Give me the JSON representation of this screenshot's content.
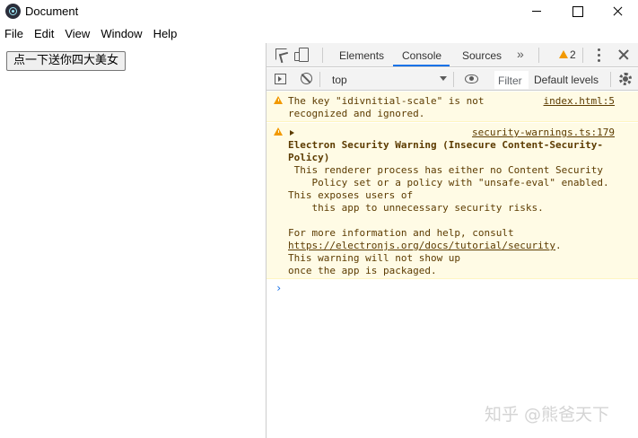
{
  "window": {
    "title": "Document",
    "controls": [
      "minimize",
      "maximize",
      "close"
    ]
  },
  "menubar": {
    "items": [
      "File",
      "Edit",
      "View",
      "Window",
      "Help"
    ]
  },
  "page": {
    "button_label": "点一下送你四大美女"
  },
  "devtools": {
    "tabs": {
      "elements": "Elements",
      "console": "Console",
      "sources": "Sources",
      "more": "»",
      "active": "Console"
    },
    "warning_count": "2",
    "toolbar": {
      "context": "top",
      "filter_placeholder": "Filter",
      "levels": "Default levels"
    },
    "messages": [
      {
        "level": "warning",
        "source": "index.html:5",
        "lines": [
          "The key \"idivnitial-scale\" is not",
          "recognized and ignored."
        ]
      },
      {
        "level": "warning",
        "source": "security-warnings.ts:179",
        "title": [
          "Electron Security Warning (Insecure Content-Security-",
          "Policy)"
        ],
        "body": [
          " This renderer process has either no Content Security",
          "    Policy set or a policy with \"unsafe-eval\" enabled.",
          "This exposes users of",
          "    this app to unnecessary security risks.",
          "",
          "For more information and help, consult"
        ],
        "link": "https://electronjs.org/docs/tutorial/security",
        "link_suffix": ".",
        "tail": [
          "This warning will not show up",
          "once the app is packaged."
        ]
      }
    ],
    "prompt": "›"
  },
  "watermark": "知乎 @熊爸天下",
  "colors": {
    "warning_bg": "#fffbe5",
    "warning_text": "#5c3b00",
    "warning_icon": "#f29900",
    "accent": "#1a73e8",
    "panel_bg": "#f3f3f3"
  }
}
